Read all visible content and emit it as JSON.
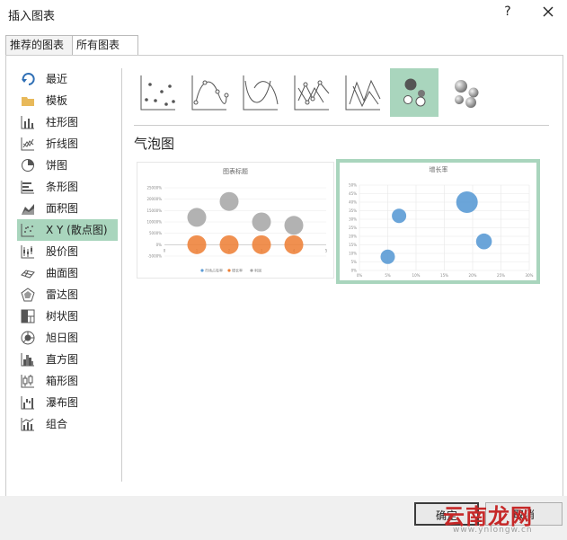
{
  "dialog": {
    "title": "插入图表",
    "help_label": "?"
  },
  "tabs": [
    {
      "label": "推荐的图表",
      "active": false
    },
    {
      "label": "所有图表",
      "active": true
    }
  ],
  "sidebar": {
    "items": [
      {
        "label": "最近",
        "icon": "recent-arrow-icon"
      },
      {
        "label": "模板",
        "icon": "folder-icon"
      },
      {
        "label": "柱形图",
        "icon": "column-chart-icon"
      },
      {
        "label": "折线图",
        "icon": "line-chart-icon"
      },
      {
        "label": "饼图",
        "icon": "pie-chart-icon"
      },
      {
        "label": "条形图",
        "icon": "bar-chart-icon"
      },
      {
        "label": "面积图",
        "icon": "area-chart-icon"
      },
      {
        "label": "X Y (散点图)",
        "icon": "scatter-chart-icon",
        "selected": true
      },
      {
        "label": "股价图",
        "icon": "stock-chart-icon"
      },
      {
        "label": "曲面图",
        "icon": "surface-chart-icon"
      },
      {
        "label": "雷达图",
        "icon": "radar-chart-icon"
      },
      {
        "label": "树状图",
        "icon": "treemap-chart-icon"
      },
      {
        "label": "旭日图",
        "icon": "sunburst-chart-icon"
      },
      {
        "label": "直方图",
        "icon": "histogram-chart-icon"
      },
      {
        "label": "箱形图",
        "icon": "box-chart-icon"
      },
      {
        "label": "瀑布图",
        "icon": "waterfall-chart-icon"
      },
      {
        "label": "组合",
        "icon": "combo-chart-icon"
      }
    ]
  },
  "subtypes": [
    {
      "icon": "scatter-icon"
    },
    {
      "icon": "scatter-smooth-markers-icon"
    },
    {
      "icon": "scatter-smooth-lines-icon"
    },
    {
      "icon": "scatter-straight-markers-icon"
    },
    {
      "icon": "scatter-straight-lines-icon"
    },
    {
      "icon": "bubble-icon",
      "selected": true
    },
    {
      "icon": "bubble-3d-icon"
    }
  ],
  "section_title": "气泡图",
  "preview1": {
    "title": "图表标题",
    "y_ticks": [
      "25000%",
      "20000%",
      "15000%",
      "10000%",
      "5000%",
      "0%",
      "-5000%"
    ],
    "x_ticks": [
      "0",
      "1",
      "2",
      "3",
      "4",
      "5"
    ],
    "legend": [
      "市场占有率",
      "增长率",
      "利润"
    ]
  },
  "preview2": {
    "title": "增长率",
    "y_ticks": [
      "50%",
      "45%",
      "40%",
      "35%",
      "30%",
      "25%",
      "20%",
      "15%",
      "10%",
      "5%",
      "0%"
    ],
    "x_ticks": [
      "0%",
      "5%",
      "10%",
      "15%",
      "20%",
      "25%",
      "30%"
    ]
  },
  "chart_data": [
    {
      "type": "scatter",
      "title": "图表标题",
      "xlim": [
        0,
        5
      ],
      "ylim": [
        -5000,
        25000
      ],
      "series": [
        {
          "name": "市场占有率",
          "color": "#ED7D31",
          "x": [
            1,
            2,
            3,
            4
          ],
          "y": [
            0,
            0,
            0,
            0
          ]
        },
        {
          "name": "增长率",
          "color": "#A5A5A5",
          "x": [
            1,
            2,
            3,
            4
          ],
          "y": [
            12000,
            19000,
            10000,
            8500
          ]
        }
      ],
      "legend": [
        "市场占有率",
        "增长率",
        "利润"
      ],
      "legend_position": "bottom"
    },
    {
      "type": "scatter",
      "title": "增长率",
      "xlim": [
        0,
        30
      ],
      "ylim": [
        0,
        50
      ],
      "color": "#5B9BD5",
      "points": [
        {
          "x": 5,
          "y": 8,
          "r": 1.0
        },
        {
          "x": 7,
          "y": 32,
          "r": 1.0
        },
        {
          "x": 19,
          "y": 40,
          "r": 1.5
        },
        {
          "x": 22,
          "y": 17,
          "r": 1.1
        }
      ],
      "grid": true
    }
  ],
  "buttons": {
    "ok": "确定",
    "cancel": "取消"
  },
  "watermark": {
    "text": "云南龙网",
    "url": "www.ynlongw.cn"
  },
  "colors": {
    "selection": "#a9d5bd",
    "bubble_blue": "#5B9BD5",
    "bubble_orange": "#ED7D31",
    "bubble_gray": "#A5A5A5"
  }
}
